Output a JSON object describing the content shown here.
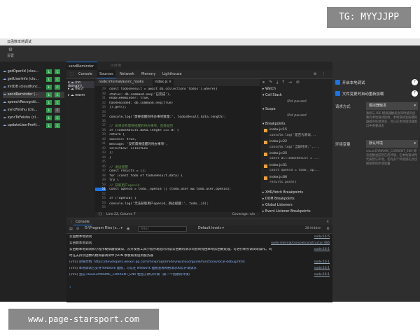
{
  "watermark_top": "TG: MYYJJPP",
  "watermark_bottom": "www.page-starsport.com",
  "window": {
    "title": "云函数本地调试",
    "settings_label": "设置"
  },
  "functions": [
    {
      "name": "getOpenId (clou...",
      "b1": "L",
      "b2": "C"
    },
    {
      "name": "getUserInfo (clo...",
      "b1": "L",
      "b2": "C"
    },
    {
      "name": "initDB (cloudfunc...",
      "b1": "L",
      "b2": "C"
    },
    {
      "name": "sendReminder (...",
      "b1": "L",
      "b2": "C"
    },
    {
      "name": "speechRecogniti...",
      "b1": "L",
      "b2": "C"
    },
    {
      "name": "syncFeishu (clo...",
      "b1": "L",
      "b2": "C"
    },
    {
      "name": "syncToFeishu (cl...",
      "b1": "L",
      "b2": "C"
    },
    {
      "name": "updateUserProfil...",
      "b1": "L",
      "b2": "C"
    }
  ],
  "function_tabs": [
    "sendReminder",
    "initDB"
  ],
  "devtools_tabs": [
    "Console",
    "Sources",
    "Network",
    "Memory",
    "Lighthouse"
  ],
  "file_tree": [
    "(no domain)",
    "file://",
    "wasm"
  ],
  "editor_tabs": [
    "node:internal/async_hooks",
    "index.js"
  ],
  "code_lines": [
    {
      "n": "29",
      "t": "  const todosResult = await db.collection('todos').where({"
    },
    {
      "n": "30",
      "t": "    status: db.command.neq('已完成'),"
    },
    {
      "n": "31",
      "t": "    enableReminder: true,"
    },
    {
      "n": "32",
      "t": "    hasReminded: db.command.neq(true)"
    },
    {
      "n": "33",
      "t": "  }).get();"
    },
    {
      "n": "34",
      "t": ""
    },
    {
      "n": "35",
      "t": "  console.log('需要提醒的待办事项数量:', todosResult.data.length);"
    },
    {
      "n": "36",
      "t": ""
    },
    {
      "n": "37",
      "t": "  // 如果没有需要提醒的待办事项，直接返回"
    },
    {
      "n": "38",
      "t": "  if (todosResult.data.length === 0) {"
    },
    {
      "n": "39",
      "t": "    return {"
    },
    {
      "n": "40",
      "t": "      success: true,"
    },
    {
      "n": "41",
      "t": "      message: '没有需要提醒的待办事项',"
    },
    {
      "n": "42",
      "t": "      isTestEnv: isTestEnv"
    },
    {
      "n": "43",
      "t": "    };"
    },
    {
      "n": "44",
      "t": "  }"
    },
    {
      "n": "45",
      "t": ""
    },
    {
      "n": "46",
      "t": "  // 发送提醒"
    },
    {
      "n": "47",
      "t": "  const results = [];"
    },
    {
      "n": "48",
      "t": "  for (const todo of todosResult.data) {"
    },
    {
      "n": "49",
      "t": "    try {"
    },
    {
      "n": "50",
      "t": "      // 获取用户openid"
    },
    {
      "n": "51",
      "t": "      const openid = todo._openid || (todo.user && todo.user.openid);"
    },
    {
      "n": "52",
      "t": ""
    },
    {
      "n": "53",
      "t": "      if (!openid) {"
    },
    {
      "n": "54",
      "t": "        console.log('无法获取用户openid，跳过提醒:', todo._id);"
    },
    {
      "n": "55",
      "t": ""
    }
  ],
  "editor_status": {
    "position": "Line 22, Column 7",
    "coverage": "Coverage: n/a"
  },
  "debugger": {
    "watch": "Watch",
    "call_stack": "Call Stack",
    "not_paused_1": "Not paused",
    "scope": "Scope",
    "not_paused_2": "Not paused",
    "breakpoints": "Breakpoints",
    "bps": [
      {
        "file": "index.js:15",
        "code": "console.log('是否为测试..."
      },
      {
        "file": "index.js:22",
        "code": "console.log('当前时间:',..."
      },
      {
        "file": "index.js:25",
        "code": "const allTodosResult = ..."
      },
      {
        "file": "index.js:51",
        "code": "const openid = todo._op..."
      },
      {
        "file": "index.js:66",
        "code": "results.push({"
      }
    ],
    "sections": [
      "XHR/fetch Breakpoints",
      "DOM Breakpoints",
      "Global Listeners",
      "Event Listener Breakpoints"
    ]
  },
  "console": {
    "tab": "Console",
    "context": "D:\\Program Files (x...",
    "filter_placeholder": "Filter",
    "levels": "Default levels",
    "hidden": "28 hidden",
    "lines": [
      {
        "text": "云函数本地调试",
        "link": "node:16:5"
      },
      {
        "text": "云函数本地调试",
        "link": "node:internal/console/constructor:466"
      },
      {
        "text": "云函数本地调试和小程序模拟器很类似，从开发者工具小程序发起的对该云函数的请求均会转而由本地云函数处理，可进行断点调试等操作。同",
        "link": "node:16:1"
      },
      {
        "text": "时在支持云函数的模拟器调试中 JSON 模板被发送到服务器",
        "link": ""
      },
      {
        "text": "[info] 详细文档: https://developers.weixin.qq.com/miniprogram/dev/wxcloud/guide/functions/local-debug.html",
        "link": "node:16:1"
      },
      {
        "text": "[info] 本地调试已支持 Network 面板，可以在 Network 面板查看网络请求和云开发请求",
        "link": "node:16:1"
      },
      {
        "text": "[info] 当前 cloud.DYNAMIC_CURRENT_ENV 相当于默认环境（第一个创建的环境）",
        "link": "node:16:1"
      }
    ]
  },
  "settings_panel": {
    "enable_local": "开启本地调试",
    "auto_reload": "文件变更时自动重新加载",
    "request_mode_label": "请求方式",
    "request_mode_value": "模拟器触发",
    "request_mode_desc": "真机与 IDE 模拟器触发会同时被云函数的本地调试接收，本地调试会按模拟器顺序处理请求，可以在本地调试器窗口中查看日志",
    "env_label": "环境变量",
    "env_value": "默认环境",
    "env_desc": "cloud.DYNAMIC_CURRENT_ENV 即云函数当前所在的环境，在本地调试时代表默认环境，若有多个环境请在此切换使用的环境变量"
  }
}
